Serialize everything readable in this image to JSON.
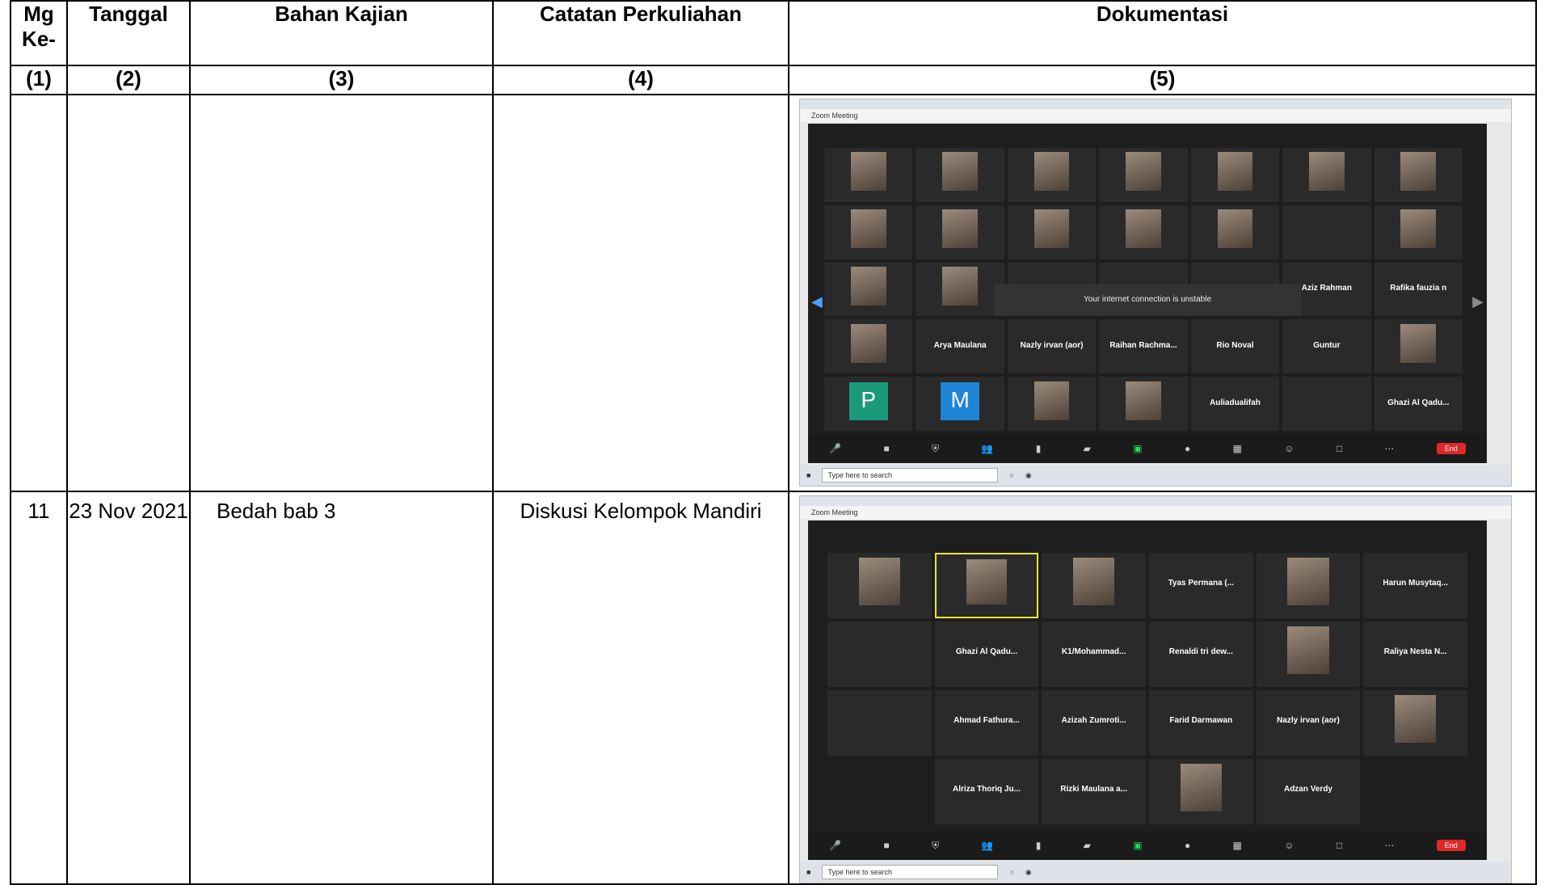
{
  "table": {
    "headers": [
      "Mg\nKe-",
      "Tanggal",
      "Bahan Kajian",
      "Catatan Perkuliahan",
      "Dokumentasi"
    ],
    "header_lines": {
      "col1_line1": "Mg",
      "col1_line2": "Ke-",
      "col2": "Tanggal",
      "col3": "Bahan Kajian",
      "col4": "Catatan Perkuliahan",
      "col5": "Dokumentasi"
    },
    "numbering": [
      "(1)",
      "(2)",
      "(3)",
      "(4)",
      "(5)"
    ],
    "rows": [
      {
        "mg": "",
        "tanggal": "",
        "bahan": "",
        "catatan": "",
        "doc": {
          "title": "Zoom Meeting",
          "toast": "Your internet connection is unstable",
          "participants": [
            "Arya Maulana",
            "Nazly irvan (aor)",
            "Raihan Rachma...",
            "Rio Noval",
            "Guntur",
            "Rafika fauzia n",
            "Aziz Rahman",
            "Ghazi Al Qadu...",
            "Auliadualifah",
            "P",
            "M"
          ],
          "search": "Type here to search"
        }
      },
      {
        "mg": "11",
        "tanggal": "23 Nov 2021",
        "bahan": "Bedah bab 3",
        "catatan": "Diskusi Kelompok Mandiri",
        "doc": {
          "title": "Zoom Meeting",
          "participants": [
            "Tyas Permana (...",
            "Harun Musytaq...",
            "Ghazi Al Qadu...",
            "K1/Mohammad...",
            "Renaldi tri dew...",
            "Raliya Nesta N...",
            "Ahmad Fathura...",
            "Azizah Zumroti...",
            "Farid Darmawan",
            "Nazly irvan (aor)",
            "Alriza Thoriq Ju...",
            "Rizki Maulana a...",
            "Adzan Verdy"
          ],
          "search": "Type here to search"
        }
      }
    ]
  },
  "colors": {
    "zoom_bg": "#1e1e1e",
    "end_button": "#e02828",
    "active_speaker": "#e6e635"
  }
}
